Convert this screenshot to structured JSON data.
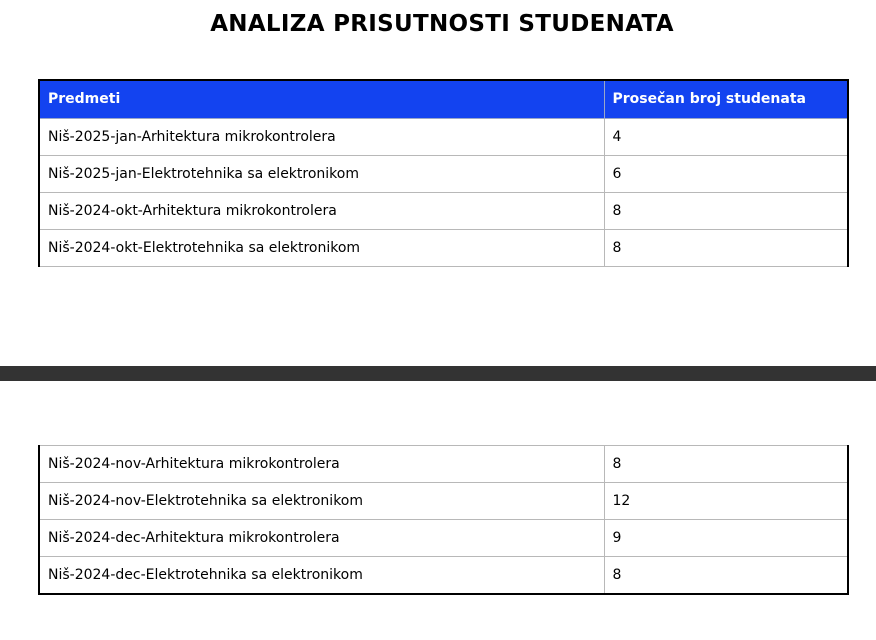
{
  "title": "ANALIZA PRISUTNOSTI STUDENATA",
  "table": {
    "headers": [
      "Predmeti",
      "Prosečan broj studenata"
    ],
    "rows_page1": [
      [
        "Niš-2025-jan-Arhitektura mikrokontrolera",
        "4"
      ],
      [
        "Niš-2025-jan-Elektrotehnika sa elektronikom",
        "6"
      ],
      [
        "Niš-2024-okt-Arhitektura mikrokontrolera",
        "8"
      ],
      [
        "Niš-2024-okt-Elektrotehnika sa elektronikom",
        "8"
      ]
    ],
    "rows_page2": [
      [
        "Niš-2024-nov-Arhitektura mikrokontrolera",
        "8"
      ],
      [
        "Niš-2024-nov-Elektrotehnika sa elektronikom",
        "12"
      ],
      [
        "Niš-2024-dec-Arhitektura mikrokontrolera",
        "9"
      ],
      [
        "Niš-2024-dec-Elektrotehnika sa elektronikom",
        "8"
      ]
    ]
  },
  "colors": {
    "header_bg": "#1343f0",
    "header_text": "#ffffff",
    "page_break": "#333333"
  }
}
